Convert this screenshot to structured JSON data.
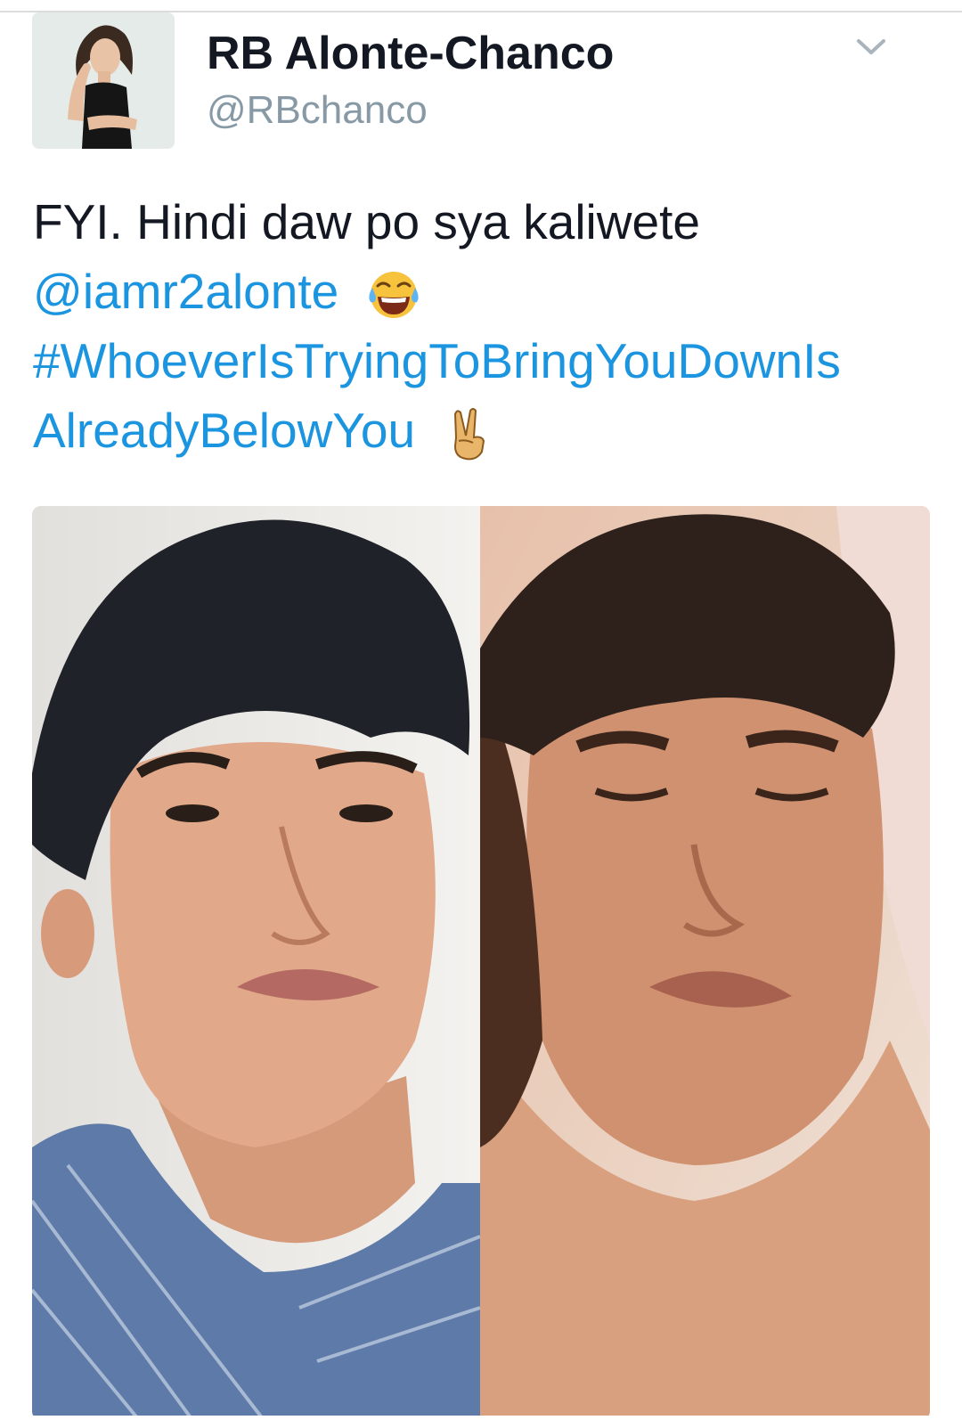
{
  "tweet": {
    "display_name": "RB Alonte-Chanco",
    "handle": "@RBchanco",
    "text_line1": "FYI. Hindi daw po sya kaliwete",
    "mention": "@iamr2alonte",
    "hashtag_part1": "#WhoeverIsTryingToBringYouDownIs",
    "hashtag_part2": "AlreadyBelowYou",
    "emoji_1": "tears-of-joy-emoji",
    "emoji_2": "victory-hand-emoji",
    "menu_icon": "chevron-down-icon",
    "link_color": "#1b95e0"
  },
  "media": {
    "photos": [
      "left-photo-selfie",
      "right-photo-video-still"
    ]
  }
}
